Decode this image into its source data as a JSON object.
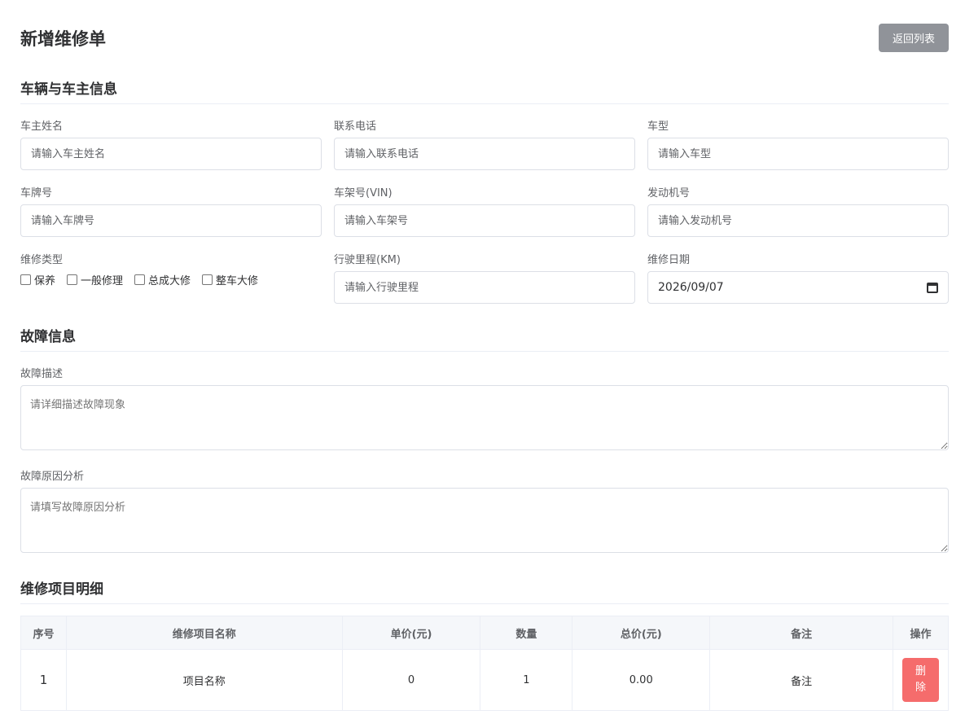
{
  "header": {
    "title": "新增维修单",
    "back_label": "返回列表"
  },
  "vehicle_section": {
    "title": "车辆与车主信息",
    "owner_name": {
      "label": "车主姓名",
      "placeholder": "请输入车主姓名"
    },
    "phone": {
      "label": "联系电话",
      "placeholder": "请输入联系电话"
    },
    "model": {
      "label": "车型",
      "placeholder": "请输入车型"
    },
    "plate": {
      "label": "车牌号",
      "placeholder": "请输入车牌号"
    },
    "vin": {
      "label": "车架号(VIN)",
      "placeholder": "请输入车架号"
    },
    "engine": {
      "label": "发动机号",
      "placeholder": "请输入发动机号"
    },
    "repair_type": {
      "label": "维修类型",
      "options": [
        "保养",
        "一般修理",
        "总成大修",
        "整车大修"
      ]
    },
    "mileage": {
      "label": "行驶里程(KM)",
      "placeholder": "请输入行驶里程"
    },
    "repair_date": {
      "label": "维修日期",
      "value": "2026/09/07"
    }
  },
  "fault_section": {
    "title": "故障信息",
    "description": {
      "label": "故障描述",
      "placeholder": "请详细描述故障现象"
    },
    "cause": {
      "label": "故障原因分析",
      "placeholder": "请填写故障原因分析"
    }
  },
  "items_section": {
    "title": "维修项目明细",
    "columns": [
      "序号",
      "维修项目名称",
      "单价(元)",
      "数量",
      "总价(元)",
      "备注",
      "操作"
    ],
    "rows": [
      {
        "index": "1",
        "name": "项目名称",
        "unit_price": "0",
        "quantity": "1",
        "total": "0.00",
        "note": "备注",
        "action": "删除"
      }
    ]
  }
}
